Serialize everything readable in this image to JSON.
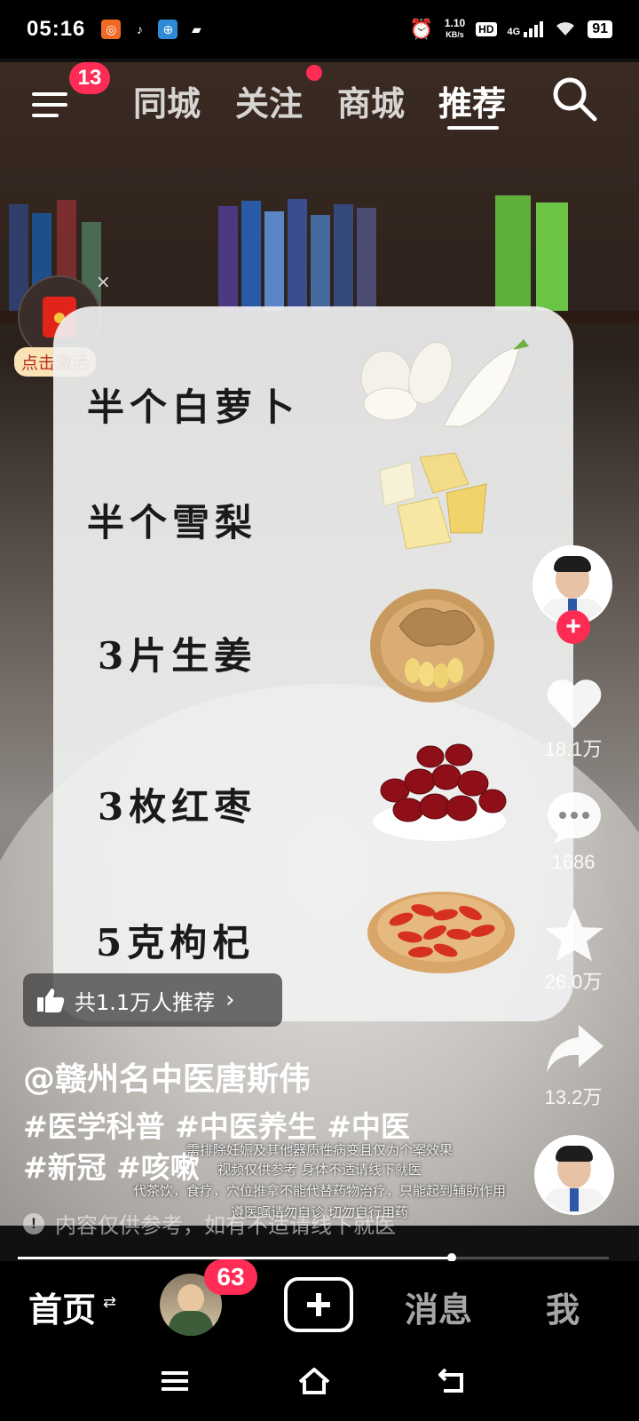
{
  "status_bar": {
    "time": "05:16",
    "net_speed_value": "1.10",
    "net_speed_unit": "KB/s",
    "hd": "HD",
    "network": "4G",
    "battery": "91"
  },
  "top_nav": {
    "menu_badge": "13",
    "tabs": [
      "同城",
      "关注",
      "商城",
      "推荐"
    ],
    "active_tab": "推荐"
  },
  "envelope_widget": {
    "label": "点击激活",
    "close": "×"
  },
  "recipe": {
    "items": [
      "半个白萝卜",
      "半个雪梨",
      "3片生姜",
      "3枚红枣",
      "5克枸杞"
    ]
  },
  "actions": {
    "likes": "18.1万",
    "comments": "1686",
    "favorites": "26.0万",
    "shares": "13.2万",
    "follow": "+"
  },
  "recommend": {
    "label": "共1.1万人推荐",
    "chevron": "›"
  },
  "caption": {
    "author": "@赣州名中医唐斯伟",
    "hashtags_line1": "#医学科普 #中医养生 #中医",
    "hashtags_line2": "#新冠 #咳嗽",
    "overlay_lines": [
      "需排除妊娠及其他器质性病变且仅为个案效果",
      "视频仅供参考 身体不适请线下就医",
      "代茶饮，食疗，穴位推拿不能代替药物治疗，只能起到辅助作用",
      "遵医嘱请勿自诊 切勿自行用药"
    ],
    "disclaimer": "内容仅供参考，如有不适请线下就医"
  },
  "playback": {
    "progress": 0.734
  },
  "bottom_tabs": {
    "home": "首页",
    "home_switch": "⇄",
    "avatar_badge": "63",
    "messages": "消息",
    "me": "我"
  },
  "colors": {
    "accent": "#ff2c55",
    "card": "#f0f0f0"
  }
}
